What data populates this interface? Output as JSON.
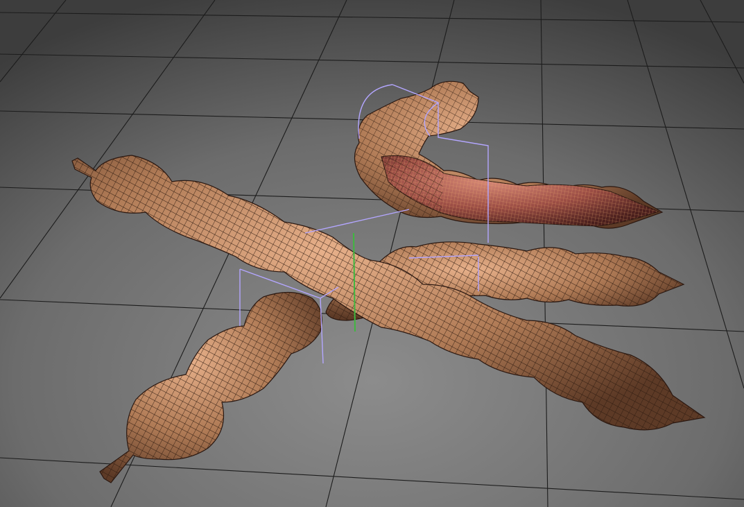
{
  "viewport": {
    "background_top": "#4e4e4e",
    "background_bottom": "#8a8a8a",
    "grid_color": "#1e1e1e"
  },
  "objects": [
    {
      "name": "pod-long-diagonal",
      "selected": false,
      "color": "#b9845f",
      "wire": "#3a2418"
    },
    {
      "name": "pod-front-left",
      "selected": false,
      "color": "#b9845f",
      "wire": "#3a2418"
    },
    {
      "name": "pod-middle-right",
      "selected": false,
      "color": "#b9845f",
      "wire": "#3a2418"
    },
    {
      "name": "pod-back-curled",
      "selected": true,
      "color": "#b9845f",
      "highlight": "#8c4a3a",
      "wire": "#3a2418"
    }
  ],
  "selection": {
    "bbox_color": "#b3a6ff",
    "axis_y_color": "#3fb83f"
  }
}
